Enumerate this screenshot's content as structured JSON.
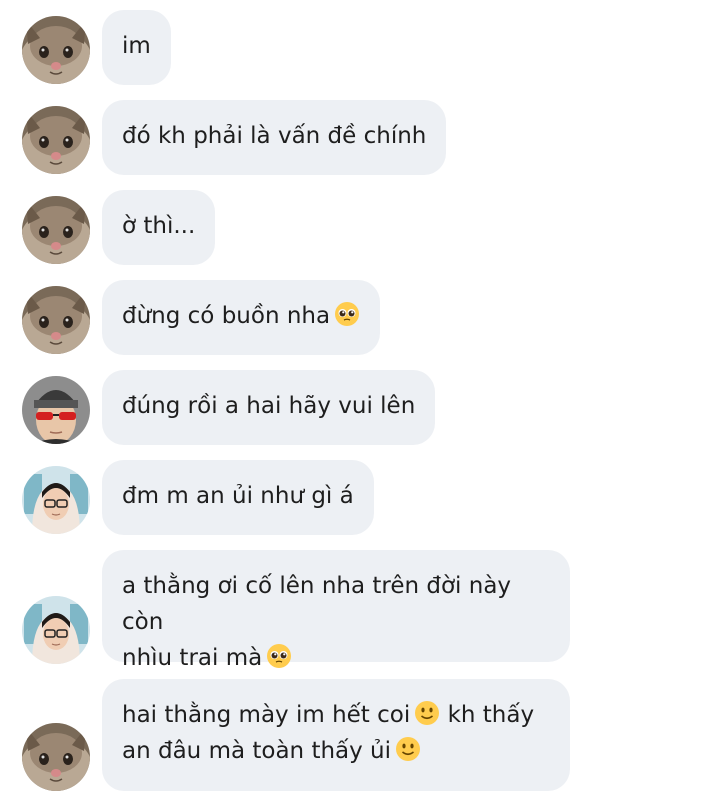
{
  "messages": [
    {
      "avatar": "cat-avatar",
      "parts": [
        {
          "text": "im"
        }
      ]
    },
    {
      "avatar": "cat-avatar",
      "parts": [
        {
          "text": "đó kh phải là vấn đề chính"
        }
      ]
    },
    {
      "avatar": "cat-avatar",
      "parts": [
        {
          "text": "ờ thì..."
        }
      ]
    },
    {
      "avatar": "cat-avatar",
      "parts": [
        {
          "text": "đừng có buồn nha"
        },
        {
          "emoji": "pleading-face-emoji"
        }
      ]
    },
    {
      "avatar": "beanie-sunglasses-avatar",
      "parts": [
        {
          "text": "đúng rồi a hai hãy vui lên"
        }
      ]
    },
    {
      "avatar": "hoodie-glasses-avatar",
      "parts": [
        {
          "text": "đm m an ủi như gì á"
        }
      ]
    },
    {
      "avatar": "hoodie-glasses-avatar",
      "parts": [
        {
          "text": "a thằng ơi cố lên nha trên đời này còn nhìu trai mà"
        },
        {
          "emoji": "pleading-face-emoji"
        }
      ]
    },
    {
      "avatar": "cat-avatar",
      "parts": [
        {
          "text": "hai thằng mày im hết coi"
        },
        {
          "emoji": "slightly-smiling-face-emoji"
        },
        {
          "text": "kh thấy an đâu mà toàn thấy ủi"
        },
        {
          "emoji": "slightly-smiling-face-emoji"
        }
      ]
    }
  ],
  "m0": {
    "t0": "im"
  },
  "m1": {
    "t0": "đó kh phải là vấn đề chính"
  },
  "m2": {
    "t0": "ờ thì..."
  },
  "m3": {
    "t0": "đừng có buồn nha"
  },
  "m4": {
    "t0": "đúng rồi a hai hãy vui lên"
  },
  "m5": {
    "t0": "đm m an ủi như gì á"
  },
  "m6": {
    "t0": "a thằng ơi cố lên nha trên đời này còn",
    "t1": "nhìu trai mà"
  },
  "m7": {
    "t0": "hai thằng mày im hết coi",
    "t1": "kh thấy",
    "t2": "an đâu mà toàn thấy ủi"
  },
  "colors": {
    "bubble": "#edf0f4",
    "text": "#1e1e1e",
    "background": "#ffffff"
  }
}
